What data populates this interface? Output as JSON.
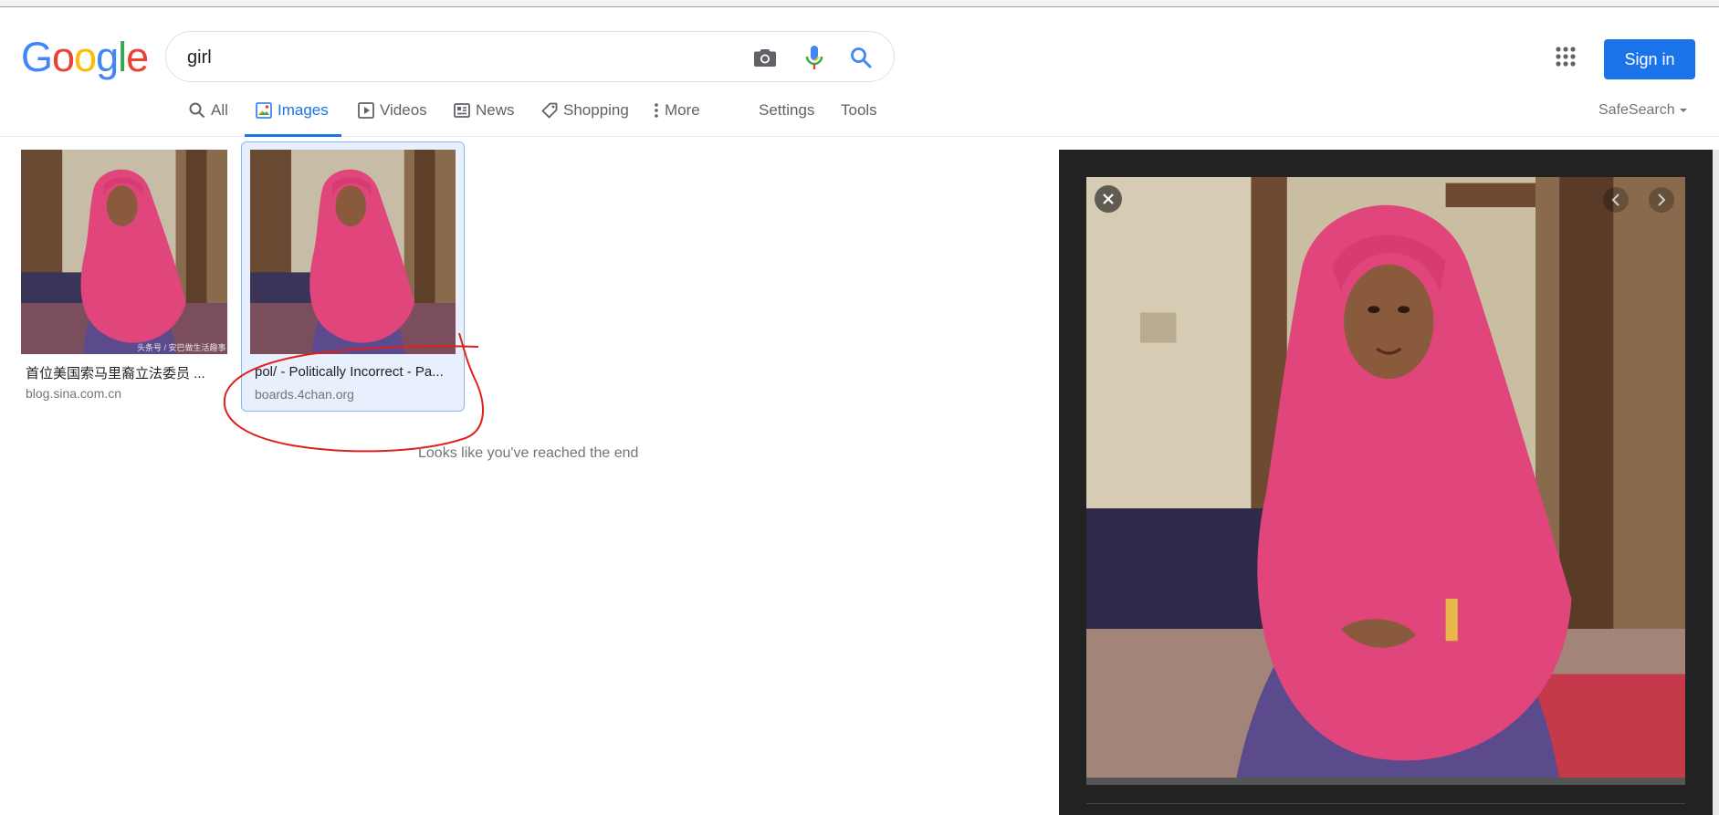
{
  "logo": {
    "letters": [
      "G",
      "o",
      "o",
      "g",
      "l",
      "e"
    ],
    "colors": [
      "#4285f4",
      "#ea4335",
      "#fbbc05",
      "#4285f4",
      "#34a853",
      "#ea4335"
    ]
  },
  "search": {
    "value": "girl"
  },
  "header": {
    "signin_label": "Sign in"
  },
  "tabs": [
    {
      "label": "All",
      "icon": "search-icon"
    },
    {
      "label": "Images",
      "icon": "image-icon",
      "active": true
    },
    {
      "label": "Videos",
      "icon": "play-icon"
    },
    {
      "label": "News",
      "icon": "news-icon"
    },
    {
      "label": "Shopping",
      "icon": "tag-icon"
    },
    {
      "label": "More",
      "icon": "more-vert-icon"
    },
    {
      "label": "Settings"
    },
    {
      "label": "Tools"
    }
  ],
  "safesearch": {
    "label": "SafeSearch"
  },
  "results": [
    {
      "title": "首位美国索马里裔立法委员 ...",
      "domain": "blog.sina.com.cn",
      "watermark": "头条号 / 安巴做生活趣事"
    },
    {
      "title": "pol/ - Politically Incorrect - Pa...",
      "domain": "boards.4chan.org",
      "selected": true
    }
  ],
  "end_message": "Looks like you've reached the end",
  "colors": {
    "accent": "#1a73e8",
    "annotation": "#e0201b",
    "scarf": "#e0457c"
  }
}
